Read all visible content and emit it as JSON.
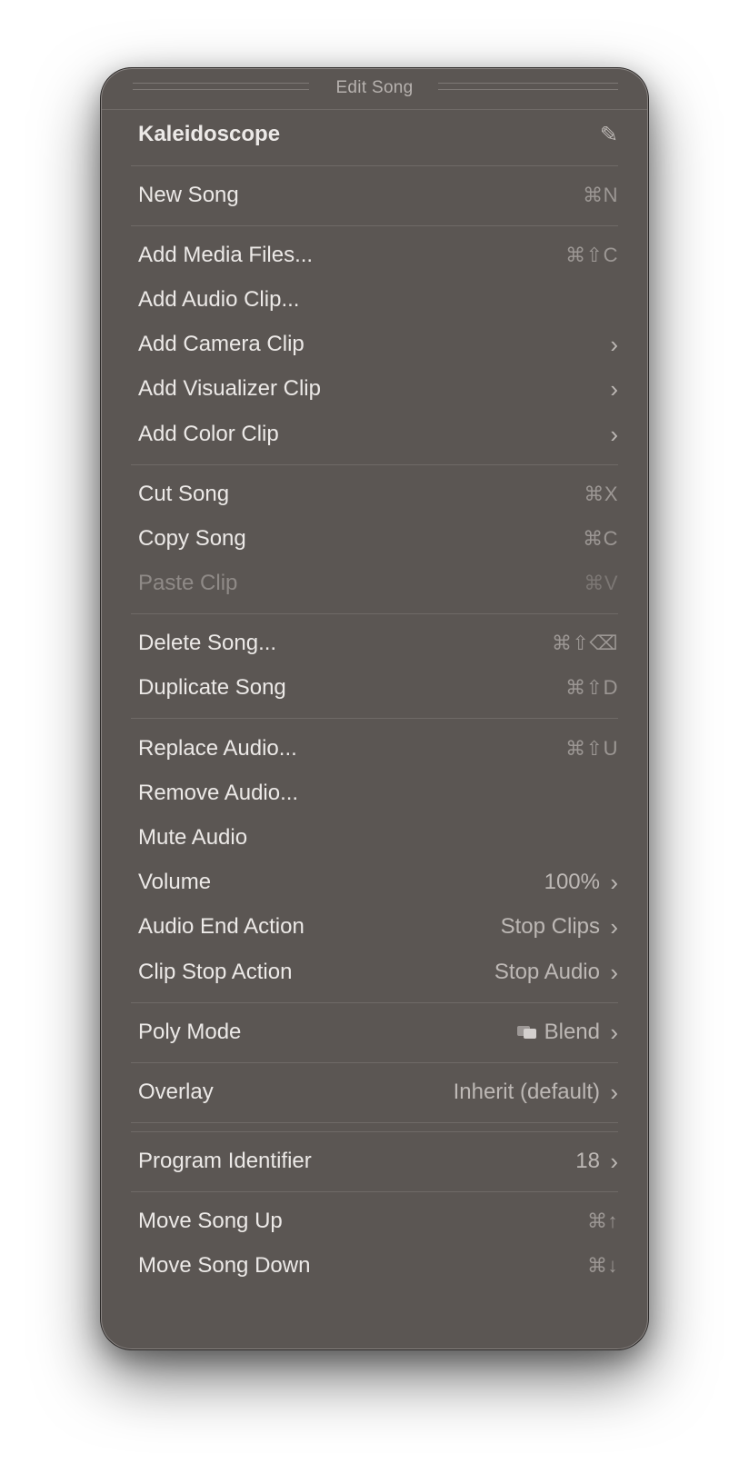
{
  "menu": {
    "title": "Edit Song",
    "song_name": "Kaleidoscope",
    "items": {
      "new_song": {
        "label": "New Song",
        "shortcut": "⌘N"
      },
      "add_media_files": {
        "label": "Add Media Files...",
        "shortcut": "⌘⇧C"
      },
      "add_audio_clip": {
        "label": "Add Audio Clip..."
      },
      "add_camera_clip": {
        "label": "Add Camera Clip"
      },
      "add_visualizer_clip": {
        "label": "Add Visualizer Clip"
      },
      "add_color_clip": {
        "label": "Add Color Clip"
      },
      "cut_song": {
        "label": "Cut Song",
        "shortcut": "⌘X"
      },
      "copy_song": {
        "label": "Copy Song",
        "shortcut": "⌘C"
      },
      "paste_clip": {
        "label": "Paste Clip",
        "shortcut": "⌘V"
      },
      "delete_song": {
        "label": "Delete Song...",
        "shortcut": "⌘⇧⌫"
      },
      "duplicate_song": {
        "label": "Duplicate Song",
        "shortcut": "⌘⇧D"
      },
      "replace_audio": {
        "label": "Replace Audio...",
        "shortcut": "⌘⇧U"
      },
      "remove_audio": {
        "label": "Remove Audio..."
      },
      "mute_audio": {
        "label": "Mute Audio"
      },
      "volume": {
        "label": "Volume",
        "value": "100%"
      },
      "audio_end_action": {
        "label": "Audio End Action",
        "value": "Stop Clips"
      },
      "clip_stop_action": {
        "label": "Clip Stop Action",
        "value": "Stop Audio"
      },
      "poly_mode": {
        "label": "Poly Mode",
        "value": "Blend"
      },
      "overlay": {
        "label": "Overlay",
        "value": "Inherit (default)"
      },
      "program_identifier": {
        "label": "Program Identifier",
        "value": "18"
      },
      "move_song_up": {
        "label": "Move Song Up",
        "shortcut": "⌘↑"
      },
      "move_song_down": {
        "label": "Move Song Down",
        "shortcut": "⌘↓"
      }
    },
    "icons": {
      "edit": "pencil-icon",
      "submenu": "chevron-right-icon",
      "poly_mode": "blend-icon"
    }
  }
}
